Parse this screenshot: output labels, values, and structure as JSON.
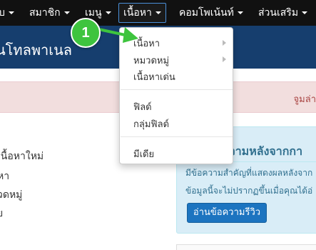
{
  "navbar": {
    "items": [
      {
        "label": "บ",
        "has_caret": true
      },
      {
        "label": "สมาชิก",
        "has_caret": true
      },
      {
        "label": "เมนู",
        "has_caret": true
      },
      {
        "label": "เนื้อหา",
        "has_caret": true,
        "active": true
      },
      {
        "label": "คอมโพเน้นท์",
        "has_caret": true
      },
      {
        "label": "ส่วนเสริม",
        "has_caret": true
      }
    ]
  },
  "header": {
    "title": "นโทลพาเนล"
  },
  "alert": {
    "text": "จูมล่า"
  },
  "left_links": [
    "เนื้อหาใหม่",
    "หา",
    "วดหมู่",
    "ย"
  ],
  "dropdown": {
    "items": [
      {
        "label": "เนื้อหา",
        "submenu": true
      },
      {
        "label": "หมวดหมู่",
        "submenu": true
      },
      {
        "label": "เนื้อหาเด่น",
        "submenu": false
      },
      {
        "label": "ฟิลด์",
        "submenu": false
      },
      {
        "label": "กลุ่มฟิลด์",
        "submenu": false
      },
      {
        "label": "มีเดีย",
        "submenu": false
      }
    ]
  },
  "panel": {
    "title": "ความหลังจากกา",
    "lines": [
      "มีข้อความสำคัญที่แสดงผลหลังจาก",
      "ข้อมูลนี้จะไม่ปรากฏขึ้นเมื่อคุณได้อ่"
    ],
    "button_label": "อ่านข้อความรีวิว"
  },
  "annotation": {
    "step": "1"
  },
  "colors": {
    "navbar_bg": "#111111",
    "header_bg": "#163e6e",
    "alert_bg": "#f2dede",
    "panel_bg": "#d9edf7",
    "button_bg": "#1c74c0",
    "annotation_green": "#3ec43e"
  }
}
